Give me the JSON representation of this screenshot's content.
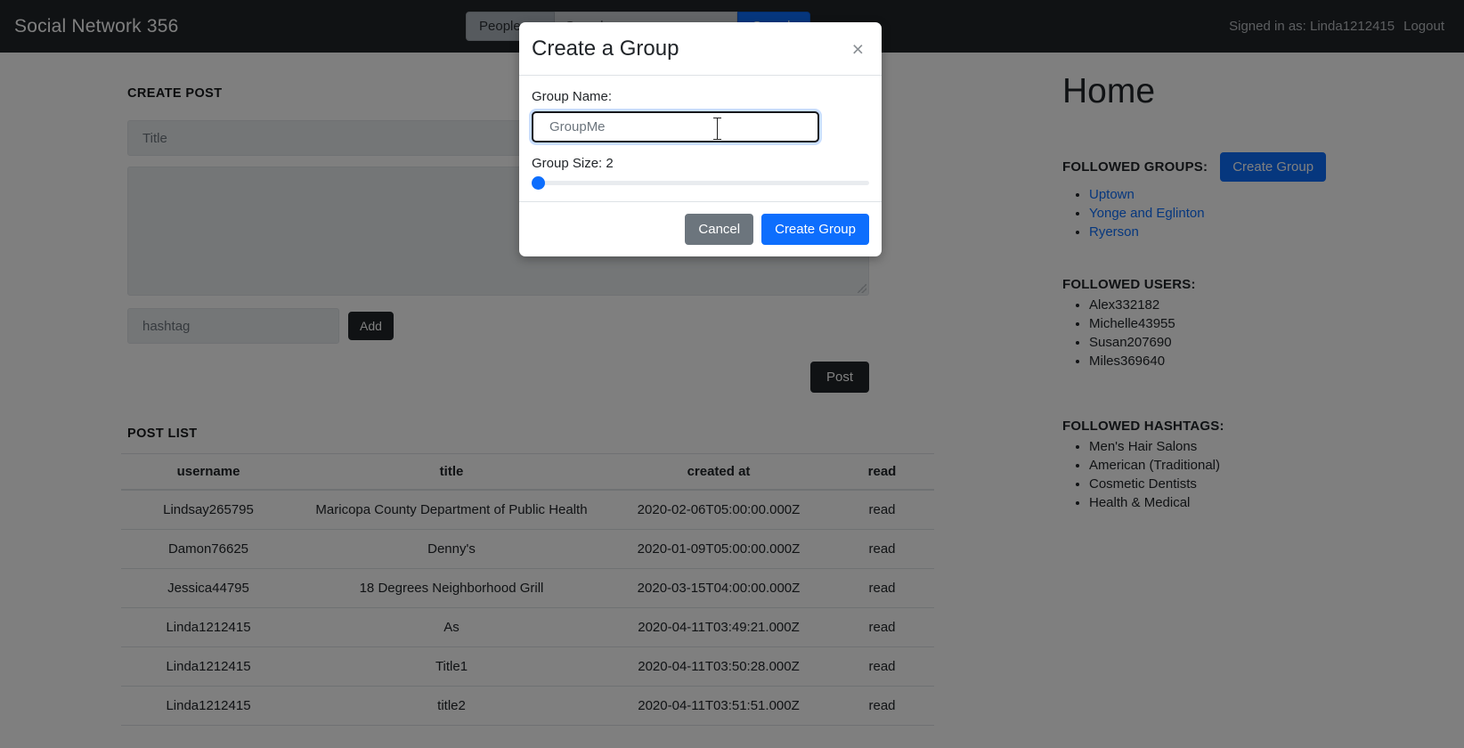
{
  "navbar": {
    "brand": "Social Network 356",
    "search_scope": "People",
    "search_placeholder": "Search",
    "search_button": "Search",
    "signed_in_text": "Signed in as: Linda1212415",
    "logout": "Logout"
  },
  "create_post": {
    "heading": "CREATE POST",
    "title_placeholder": "Title",
    "body_placeholder": "",
    "hashtag_placeholder": "hashtag",
    "add_button": "Add",
    "post_button": "Post"
  },
  "post_list": {
    "heading": "POST LIST",
    "columns": [
      "username",
      "title",
      "created at",
      "read"
    ],
    "rows": [
      {
        "username": "Lindsay265795",
        "title": "Maricopa County Department of Public Health",
        "created_at": "2020-02-06T05:00:00.000Z",
        "read": "read"
      },
      {
        "username": "Damon76625",
        "title": "Denny's",
        "created_at": "2020-01-09T05:00:00.000Z",
        "read": "read"
      },
      {
        "username": "Jessica44795",
        "title": "18 Degrees Neighborhood Grill",
        "created_at": "2020-03-15T04:00:00.000Z",
        "read": "read"
      },
      {
        "username": "Linda1212415",
        "title": "As",
        "created_at": "2020-04-11T03:49:21.000Z",
        "read": "read"
      },
      {
        "username": "Linda1212415",
        "title": "Title1",
        "created_at": "2020-04-11T03:50:28.000Z",
        "read": "read"
      },
      {
        "username": "Linda1212415",
        "title": "title2",
        "created_at": "2020-04-11T03:51:51.000Z",
        "read": "read"
      }
    ]
  },
  "sidebar": {
    "page_title": "Home",
    "followed_groups_label": "FOLLOWED GROUPS:",
    "create_group_button": "Create Group",
    "groups": [
      "Uptown",
      "Yonge and Eglinton",
      "Ryerson"
    ],
    "followed_users_label": "FOLLOWED USERS:",
    "users": [
      "Alex332182",
      "Michelle43955",
      "Susan207690",
      "Miles369640"
    ],
    "followed_hashtags_label": "FOLLOWED HASHTAGS:",
    "hashtags": [
      "Men's Hair Salons",
      "American (Traditional)",
      "Cosmetic Dentists",
      "Health & Medical"
    ]
  },
  "modal": {
    "title": "Create a Group",
    "close_icon": "×",
    "group_name_label": "Group Name:",
    "group_name_value": "GroupMe",
    "group_name_placeholder": "GroupMe",
    "group_size_label": "Group Size: 2",
    "group_size_value": "2",
    "group_size_min": "2",
    "group_size_max": "50",
    "cancel_button": "Cancel",
    "create_button": "Create Group"
  },
  "colors": {
    "navbar_bg": "#212529",
    "primary": "#0d6efd",
    "secondary": "#6c757d"
  }
}
